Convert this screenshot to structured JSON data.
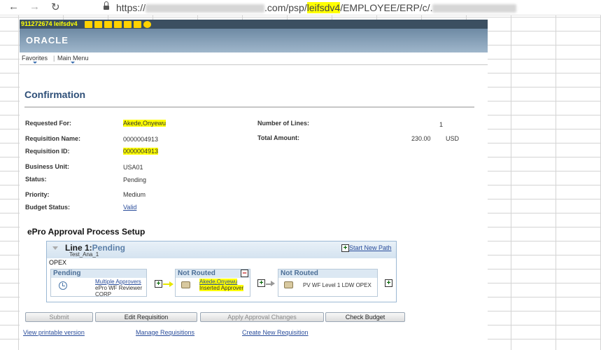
{
  "browser": {
    "url_prefix": "https://",
    "url_mid": ".com/psp/",
    "url_env": "leifsdv4",
    "url_suffix": "/EMPLOYEE/ERP/c/."
  },
  "ps_bar": {
    "text": "911272674  leifsdv4"
  },
  "header": {
    "logo": "ORACLE"
  },
  "menu": {
    "favorites": "Favorites",
    "main_menu": "Main Menu"
  },
  "page": {
    "title": "Confirmation"
  },
  "fields": {
    "requested_for_label": "Requested For:",
    "requested_for": "Akede,Onyewu",
    "req_name_label": "Requisition Name:",
    "req_name": "0000004913",
    "req_id_label": "Requisition ID:",
    "req_id": "0000004913",
    "bu_label": "Business Unit:",
    "bu": "USA01",
    "status_label": "Status:",
    "status": "Pending",
    "priority_label": "Priority:",
    "priority": "Medium",
    "budget_label": "Budget Status:",
    "budget": "Valid",
    "lines_label": "Number of Lines:",
    "lines": "1",
    "total_label": "Total Amount:",
    "total": "230.00",
    "currency": "USD"
  },
  "approval": {
    "section_title": "ePro Approval Process Setup",
    "line_label": "Line 1:",
    "line_status": "Pending",
    "line_sub": "Test_Ana_1",
    "start_new_path": "Start New Path",
    "opex": "OPEX",
    "stage1": {
      "head": "Pending",
      "link": "Multiple Approvers",
      "sub": "ePro WF Reviewer CORP"
    },
    "stage2": {
      "head": "Not Routed",
      "link": "Akede,Onyewu",
      "sub": "Inserted Approver"
    },
    "stage3": {
      "head": "Not Routed",
      "sub": "PV WF Level 1 LDW OPEX"
    }
  },
  "buttons": {
    "submit": "Submit",
    "edit": "Edit Requisition",
    "apply": "Apply Approval Changes",
    "check": "Check Budget"
  },
  "links": {
    "printable": "View printable version",
    "manage": "Manage Requisitions",
    "create": "Create New Requisition"
  }
}
